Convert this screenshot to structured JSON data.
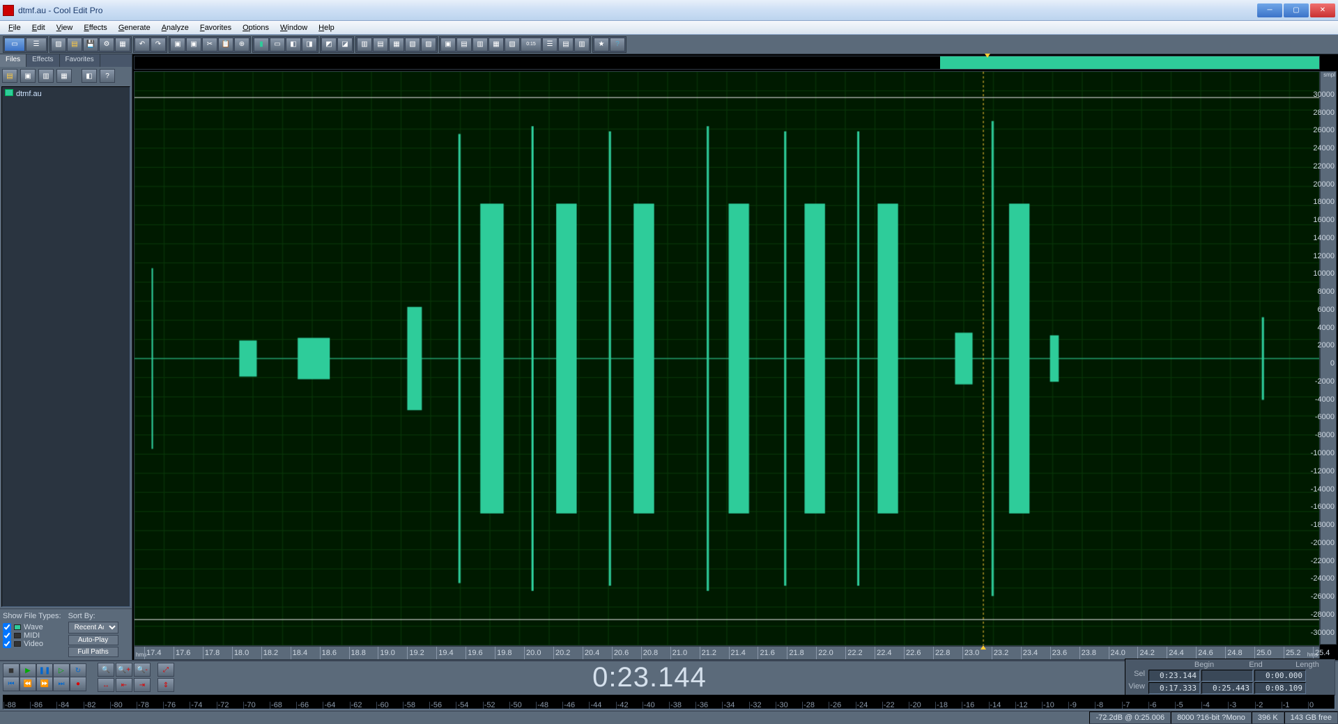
{
  "title": "dtmf.au - Cool Edit Pro",
  "menus": [
    "File",
    "Edit",
    "View",
    "Effects",
    "Generate",
    "Analyze",
    "Favorites",
    "Options",
    "Window",
    "Help"
  ],
  "leftpanel": {
    "tabs": [
      "Files",
      "Effects",
      "Favorites"
    ],
    "active_tab": 0,
    "file": "dtmf.au",
    "show_types_label": "Show File Types:",
    "sort_label": "Sort By:",
    "types": [
      {
        "label": "Wave",
        "checked": true,
        "icon_bg": "#2ecc9a"
      },
      {
        "label": "MIDI",
        "checked": true,
        "icon_bg": "#333"
      },
      {
        "label": "Video",
        "checked": true,
        "icon_bg": "#333"
      }
    ],
    "sort_value": "Recent Ac",
    "btn_autoplay": "Auto-Play",
    "btn_fullpaths": "Full Paths"
  },
  "overview": {
    "vis_start_pct": 68,
    "vis_end_pct": 100,
    "cursor_pct": 72
  },
  "amp_ruler": {
    "unit": "smpl",
    "labels": [
      30000,
      28000,
      26000,
      24000,
      22000,
      20000,
      18000,
      16000,
      14000,
      12000,
      10000,
      8000,
      6000,
      4000,
      2000,
      0,
      -2000,
      -4000,
      -6000,
      -8000,
      -10000,
      -12000,
      -14000,
      -16000,
      -18000,
      -20000,
      -22000,
      -24000,
      -26000,
      -28000,
      -30000
    ]
  },
  "time_ruler": {
    "unit": "hms",
    "start": 17.333,
    "end": 25.443,
    "ticks": [
      "17.4",
      "17.6",
      "17.8",
      "18.0",
      "18.2",
      "18.4",
      "18.6",
      "18.8",
      "19.0",
      "19.2",
      "19.4",
      "19.6",
      "19.8",
      "20.0",
      "20.2",
      "20.4",
      "20.6",
      "20.8",
      "21.0",
      "21.2",
      "21.4",
      "21.6",
      "21.8",
      "22.0",
      "22.2",
      "22.4",
      "22.6",
      "22.8",
      "23.0",
      "23.2",
      "23.4",
      "23.6",
      "23.8",
      "24.0",
      "24.2",
      "24.4",
      "24.6",
      "24.8",
      "25.0",
      "25.2",
      "25.4"
    ],
    "cursor_time": 23.144
  },
  "waveform": {
    "cursor_time": 23.144,
    "bursts": [
      {
        "t": 17.45,
        "w": 0.01,
        "a": 0.35
      },
      {
        "t": 18.05,
        "w": 0.12,
        "a": 0.07
      },
      {
        "t": 18.45,
        "w": 0.22,
        "a": 0.08
      },
      {
        "t": 19.2,
        "w": 0.1,
        "a": 0.2
      },
      {
        "t": 19.55,
        "w": 0.015,
        "a": 0.87
      },
      {
        "t": 19.7,
        "w": 0.16,
        "a": 0.6
      },
      {
        "t": 20.05,
        "w": 0.015,
        "a": 0.9
      },
      {
        "t": 20.22,
        "w": 0.14,
        "a": 0.6
      },
      {
        "t": 20.58,
        "w": 0.015,
        "a": 0.88
      },
      {
        "t": 20.75,
        "w": 0.14,
        "a": 0.6
      },
      {
        "t": 21.25,
        "w": 0.015,
        "a": 0.9
      },
      {
        "t": 21.4,
        "w": 0.14,
        "a": 0.6
      },
      {
        "t": 21.78,
        "w": 0.015,
        "a": 0.88
      },
      {
        "t": 21.92,
        "w": 0.14,
        "a": 0.6
      },
      {
        "t": 22.28,
        "w": 0.015,
        "a": 0.88
      },
      {
        "t": 22.42,
        "w": 0.14,
        "a": 0.6
      },
      {
        "t": 22.95,
        "w": 0.12,
        "a": 0.1
      },
      {
        "t": 23.2,
        "w": 0.015,
        "a": 0.92
      },
      {
        "t": 23.32,
        "w": 0.14,
        "a": 0.6
      },
      {
        "t": 23.6,
        "w": 0.06,
        "a": 0.09
      },
      {
        "t": 25.05,
        "w": 0.015,
        "a": 0.16
      }
    ]
  },
  "big_time": "0:23.144",
  "sel_info": {
    "hdr": [
      "Begin",
      "End",
      "Length"
    ],
    "rows": [
      {
        "label": "Sel",
        "vals": [
          "0:23.144",
          "",
          "0:00.000"
        ]
      },
      {
        "label": "View",
        "vals": [
          "0:17.333",
          "0:25.443",
          "0:08.109"
        ]
      }
    ]
  },
  "meter_scale": [
    "-88",
    "-86",
    "-84",
    "-82",
    "-80",
    "-78",
    "-76",
    "-74",
    "-72",
    "-70",
    "-68",
    "-66",
    "-64",
    "-62",
    "-60",
    "-58",
    "-56",
    "-54",
    "-52",
    "-50",
    "-48",
    "-46",
    "-44",
    "-42",
    "-40",
    "-38",
    "-36",
    "-34",
    "-32",
    "-30",
    "-28",
    "-26",
    "-24",
    "-22",
    "-20",
    "-18",
    "-16",
    "-14",
    "-12",
    "-10",
    "-9",
    "-8",
    "-7",
    "-6",
    "-5",
    "-4",
    "-3",
    "-2",
    "-1",
    "0"
  ],
  "status": {
    "db": "-72.2dB @ 0:25.006",
    "format": "8000 ?16-bit ?Mono",
    "size": "396 K",
    "disk": "143 GB free"
  }
}
